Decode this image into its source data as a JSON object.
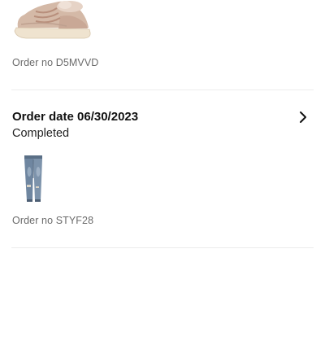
{
  "orders": [
    {
      "order_no": "Order no D5MVVD",
      "product_image": "sneaker-thumbnail"
    },
    {
      "order_date": "Order date 06/30/2023",
      "status": "Completed",
      "order_no": "Order no STYF28",
      "product_image": "jeans-thumbnail"
    }
  ],
  "icons": {
    "chevron": "chevron-right-icon"
  },
  "colors": {
    "text_primary": "#111111",
    "text_secondary": "#6b6b6b",
    "divider": "#ececec",
    "background": "#ffffff"
  }
}
